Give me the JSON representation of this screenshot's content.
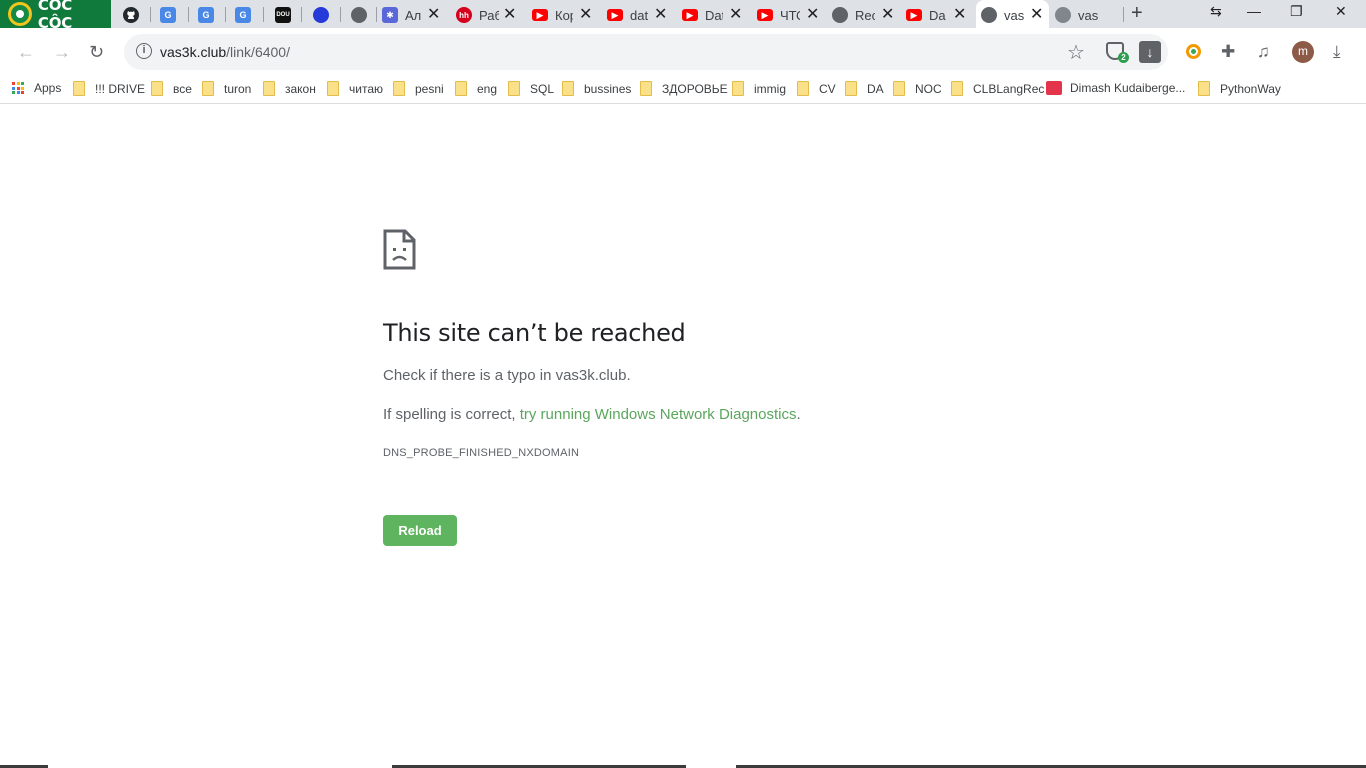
{
  "browser": {
    "brand": "CÔC CÔC",
    "tabs": [
      {
        "name": "github",
        "title": "",
        "favicon": "github-icon"
      },
      {
        "name": "translate-1",
        "title": "",
        "favicon": "google-translate-icon"
      },
      {
        "name": "translate-2",
        "title": "",
        "favicon": "google-translate-icon"
      },
      {
        "name": "translate-3",
        "title": "",
        "favicon": "google-translate-icon"
      },
      {
        "name": "dou",
        "title": "DOU",
        "favicon": "dou-icon"
      },
      {
        "name": "blue-dot",
        "title": "",
        "favicon": "blue-circle-icon"
      },
      {
        "name": "globe-1",
        "title": "",
        "favicon": "globe-icon"
      },
      {
        "name": "al",
        "title": "Ал",
        "favicon": "puzzle-icon"
      },
      {
        "name": "hh",
        "title": "Раб",
        "favicon": "hh-icon",
        "badge": "hh"
      },
      {
        "name": "yt-1",
        "title": "Кор",
        "favicon": "youtube-icon"
      },
      {
        "name": "yt-2",
        "title": "dat",
        "favicon": "youtube-icon"
      },
      {
        "name": "yt-3",
        "title": "Dat",
        "favicon": "youtube-icon"
      },
      {
        "name": "yt-4",
        "title": "ЧТО",
        "favicon": "youtube-icon"
      },
      {
        "name": "rec",
        "title": "Rec",
        "favicon": "globe-icon"
      },
      {
        "name": "yt-5",
        "title": "Da",
        "favicon": "youtube-icon"
      },
      {
        "name": "active",
        "title": "vas",
        "favicon": "globe-icon"
      },
      {
        "name": "last",
        "title": "vas",
        "favicon": "globe-icon"
      }
    ],
    "new_tab": "+",
    "window": {
      "minimize": "—",
      "restore": "❐",
      "close": "✕"
    },
    "url_host": "vas3k.club",
    "url_path": "/link/6400/",
    "avatar_letter": "m",
    "shield_badge": "2"
  },
  "bookmarks": [
    {
      "label": "Apps",
      "type": "apps"
    },
    {
      "label": "!!! DRIVE",
      "type": "folder"
    },
    {
      "label": "все",
      "type": "folder"
    },
    {
      "label": "turon",
      "type": "folder"
    },
    {
      "label": "закон",
      "type": "folder"
    },
    {
      "label": "читаю",
      "type": "folder"
    },
    {
      "label": "pesni",
      "type": "folder"
    },
    {
      "label": "eng",
      "type": "folder"
    },
    {
      "label": "SQL",
      "type": "folder"
    },
    {
      "label": "bussines",
      "type": "folder"
    },
    {
      "label": "ЗДОРОВЬЕ",
      "type": "folder"
    },
    {
      "label": "immig",
      "type": "folder"
    },
    {
      "label": "CV",
      "type": "folder"
    },
    {
      "label": "DA",
      "type": "folder"
    },
    {
      "label": "NOC",
      "type": "folder"
    },
    {
      "label": "CLBLangRec",
      "type": "folder"
    },
    {
      "label": "Dimash Kudaiberge...",
      "type": "site"
    },
    {
      "label": "PythonWay",
      "type": "folder"
    }
  ],
  "error": {
    "title": "This site can’t be reached",
    "line1": "Check if there is a typo in vas3k.club.",
    "line2_prefix": "If spelling is correct, ",
    "line2_link": "try running Windows Network Diagnostics",
    "line2_suffix": ".",
    "code": "DNS_PROBE_FINISHED_NXDOMAIN",
    "reload_label": "Reload"
  },
  "colors": {
    "accent": "#5fb45f",
    "link": "#5aa65d",
    "youtube": "#ff0000",
    "brand": "#0f7a3c"
  }
}
